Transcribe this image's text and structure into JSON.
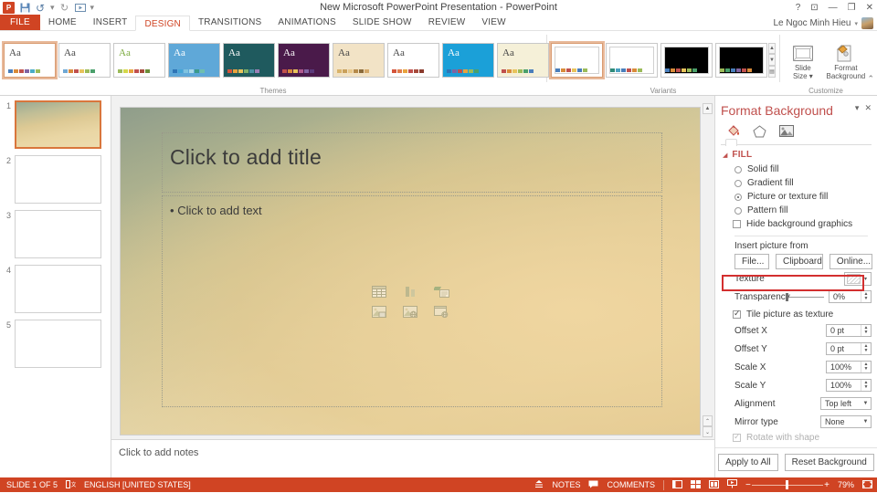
{
  "window": {
    "title": "New Microsoft PowerPoint Presentation - PowerPoint",
    "help_icon": "?",
    "ribbon_display_icon": "⊡",
    "minimize_icon": "—",
    "restore_icon": "❐",
    "close_icon": "✕"
  },
  "qat": {
    "app_icon": "P",
    "save_icon": "save-icon",
    "undo_icon": "↺",
    "undo_caret": "▾",
    "redo_icon": "↻",
    "start_slideshow_icon": "▭",
    "more_icon": "▾"
  },
  "account": {
    "name": "Le Ngoc Minh Hieu",
    "caret": "▾"
  },
  "tabs": [
    {
      "label": "FILE",
      "active": false,
      "file": true
    },
    {
      "label": "HOME",
      "active": false
    },
    {
      "label": "INSERT",
      "active": false
    },
    {
      "label": "DESIGN",
      "active": true
    },
    {
      "label": "TRANSITIONS",
      "active": false
    },
    {
      "label": "ANIMATIONS",
      "active": false
    },
    {
      "label": "SLIDE SHOW",
      "active": false
    },
    {
      "label": "REVIEW",
      "active": false
    },
    {
      "label": "VIEW",
      "active": false
    }
  ],
  "ribbon": {
    "themes_group_label": "Themes",
    "variants_group_label": "Variants",
    "customize_group_label": "Customize",
    "collapse_ribbon_icon": "⌃",
    "themes": [
      {
        "name": "office-theme",
        "aa": "Aa",
        "selected": true,
        "bg": "#ffffff",
        "aa_color": "#444444",
        "swatches": [
          "#4a7ebb",
          "#d98b3a",
          "#c0504d",
          "#8064a2",
          "#4bacc6",
          "#9bbb59"
        ]
      },
      {
        "name": "facet-theme",
        "aa": "Aa",
        "selected": false,
        "bg": "#ffffff",
        "aa_color": "#444444",
        "swatches": [
          "#6fa8d4",
          "#d98b3a",
          "#c0504d",
          "#e8c35b",
          "#9bbb59",
          "#4aa06b"
        ]
      },
      {
        "name": "ion-theme",
        "aa": "Aa",
        "selected": false,
        "bg": "#ffffff",
        "aa_color": "#7aa93c",
        "swatches": [
          "#9bbb59",
          "#d4d84a",
          "#e8a33d",
          "#c0504d",
          "#a64b3c",
          "#6b8e3a"
        ]
      },
      {
        "name": "wisp-theme",
        "aa": "Aa",
        "selected": false,
        "bg": "#5fa8d8",
        "aa_color": "#ffffff",
        "swatches": [
          "#2e75b6",
          "#45a6d6",
          "#7fc3e0",
          "#a8d8e8",
          "#3b9a8a",
          "#6fbfae"
        ]
      },
      {
        "name": "banded-theme",
        "aa": "Aa",
        "selected": false,
        "bg": "#1f5a5e",
        "aa_color": "#ffffff",
        "swatches": [
          "#d4543a",
          "#e8a33d",
          "#e8c35b",
          "#7fb069",
          "#4a90a4",
          "#9b7fb5"
        ]
      },
      {
        "name": "berlin-theme",
        "aa": "Aa",
        "selected": false,
        "bg": "#4a1a4a",
        "aa_color": "#ffffff",
        "swatches": [
          "#c0504d",
          "#d98b3a",
          "#e8c35b",
          "#b05a8f",
          "#8064a2",
          "#5a3a7a"
        ]
      },
      {
        "name": "celestial-theme",
        "aa": "Aa",
        "selected": false,
        "bg": "#f2e3c6",
        "aa_color": "#444444",
        "swatches": [
          "#d9b36a",
          "#c9a05a",
          "#e8c88a",
          "#b58a4a",
          "#8a6a3a",
          "#d4a96a"
        ]
      },
      {
        "name": "circuit-theme",
        "aa": "Aa",
        "selected": false,
        "bg": "#ffffff",
        "aa_color": "#444444",
        "swatches": [
          "#d4543a",
          "#e07b4a",
          "#e8a33d",
          "#c0504d",
          "#a64b3c",
          "#8a3a2c"
        ]
      },
      {
        "name": "damask-theme",
        "aa": "Aa",
        "selected": false,
        "bg": "#1ba0d8",
        "aa_color": "#ffffff",
        "swatches": [
          "#2e75b6",
          "#8064a2",
          "#c0504d",
          "#e8a33d",
          "#9bbb59",
          "#4aa06b"
        ]
      },
      {
        "name": "depth-theme",
        "aa": "Aa",
        "selected": false,
        "bg": "#f5f0d8",
        "aa_color": "#444444",
        "swatches": [
          "#c0504d",
          "#d98b3a",
          "#e8c35b",
          "#9bbb59",
          "#4aa06b",
          "#4a7ebb"
        ]
      }
    ],
    "theme_scroll": {
      "up": "▲",
      "down": "▼",
      "more": "▤"
    },
    "variants": [
      {
        "name": "variant-1",
        "selected": true,
        "bg": "#ffffff",
        "swatches": [
          "#4a7ebb",
          "#d98b3a",
          "#c0504d",
          "#e8c35b",
          "#4a7ebb",
          "#9bbb59"
        ]
      },
      {
        "name": "variant-2",
        "selected": false,
        "bg": "#ffffff",
        "swatches": [
          "#2e8b7a",
          "#4aa0c0",
          "#4a7ebb",
          "#c0504d",
          "#d98b3a",
          "#9bbb59"
        ]
      },
      {
        "name": "variant-3",
        "selected": false,
        "bg": "#000000",
        "swatches": [
          "#4a7ebb",
          "#d98b3a",
          "#c0504d",
          "#e8c35b",
          "#9bbb59",
          "#4aa06b"
        ]
      },
      {
        "name": "variant-4",
        "selected": false,
        "bg": "#000000",
        "swatches": [
          "#9bbb59",
          "#4aa06b",
          "#4a7ebb",
          "#8064a2",
          "#c0504d",
          "#d98b3a"
        ]
      }
    ],
    "variant_scroll": {
      "up": "▲",
      "down": "▼",
      "more": "▤"
    },
    "slide_size_label_1": "Slide",
    "slide_size_label_2": "Size",
    "slide_size_caret": "▾",
    "format_background_label_1": "Format",
    "format_background_label_2": "Background"
  },
  "slides_pane": {
    "slides": [
      {
        "number": "1",
        "selected": true,
        "filled": true
      },
      {
        "number": "2",
        "selected": false,
        "filled": false
      },
      {
        "number": "3",
        "selected": false,
        "filled": false
      },
      {
        "number": "4",
        "selected": false,
        "filled": false
      },
      {
        "number": "5",
        "selected": false,
        "filled": false
      }
    ]
  },
  "slide": {
    "title_placeholder": "Click to add title",
    "body_placeholder": "Click to add text",
    "body_bullet": "•",
    "content_icons": [
      "insert-table-icon",
      "insert-chart-icon",
      "insert-smartart-icon",
      "insert-picture-icon",
      "insert-online-picture-icon",
      "insert-video-icon"
    ],
    "scroll": {
      "up": "▲",
      "prev": "⌃",
      "next": "⌄"
    }
  },
  "notes": {
    "placeholder": "Click to add notes"
  },
  "panel": {
    "title": "Format Background",
    "menu_icon": "▾",
    "close_icon": "✕",
    "tabs": [
      {
        "name": "fill-tab",
        "icon": "fill-bucket-icon",
        "active": true
      },
      {
        "name": "effects-tab",
        "icon": "pentagon-effects-icon",
        "active": false
      },
      {
        "name": "picture-tab",
        "icon": "picture-icon",
        "active": false
      }
    ],
    "fill_section": {
      "expand_icon": "◢",
      "label": "FILL",
      "options": [
        {
          "label": "Solid fill",
          "type": "radio",
          "checked": false
        },
        {
          "label": "Gradient fill",
          "type": "radio",
          "checked": false
        },
        {
          "label": "Picture or texture fill",
          "type": "radio",
          "checked": true
        },
        {
          "label": "Pattern fill",
          "type": "radio",
          "checked": false
        },
        {
          "label": "Hide background graphics",
          "type": "checkbox",
          "checked": false
        }
      ],
      "insert_picture_label": "Insert picture from",
      "insert_buttons": [
        "File...",
        "Clipboard",
        "Online..."
      ],
      "texture_label": "Texture",
      "texture_arrow": "▾",
      "transparency_label": "Transparency",
      "transparency_value": "0%",
      "tile_label": "Tile picture as texture",
      "tile_checked": true,
      "fields": [
        {
          "label": "Offset X",
          "value": "0 pt",
          "type": "spin"
        },
        {
          "label": "Offset Y",
          "value": "0 pt",
          "type": "spin"
        },
        {
          "label": "Scale X",
          "value": "100%",
          "type": "spin"
        },
        {
          "label": "Scale Y",
          "value": "100%",
          "type": "spin"
        },
        {
          "label": "Alignment",
          "value": "Top left",
          "type": "combo"
        },
        {
          "label": "Mirror type",
          "value": "None",
          "type": "combo"
        }
      ],
      "rotate_label": "Rotate with shape",
      "rotate_checked": true
    },
    "footer_buttons": [
      "Apply to All",
      "Reset Background"
    ],
    "highlight_color": "#d32f2f"
  },
  "status": {
    "slide_count": "SLIDE 1 OF 5",
    "language_icon": "language-icon",
    "language": "ENGLISH [UNITED STATES]",
    "notes_label": "NOTES",
    "notes_icon": "notes-icon",
    "comments_label": "COMMENTS",
    "comments_icon": "comment-icon",
    "view_normal_icon": "normal-view-icon",
    "view_sorter_icon": "slide-sorter-icon",
    "view_reading_icon": "reading-view-icon",
    "view_slideshow_icon": "slideshow-icon",
    "zoom_out_icon": "−",
    "zoom_in_icon": "+",
    "zoom_level": "79%",
    "fit_icon": "fit-slide-icon"
  },
  "theme_colors": {
    "accent": "#d04423",
    "panel_title": "#c0504d",
    "highlight": "#d32f2f"
  }
}
